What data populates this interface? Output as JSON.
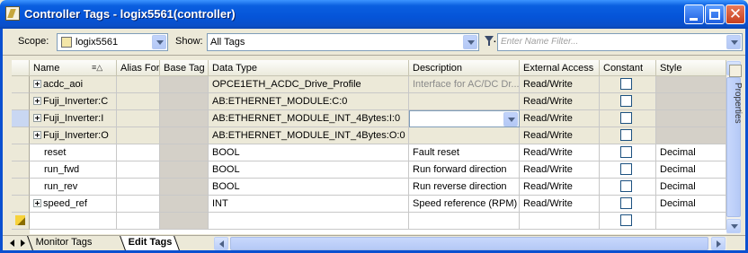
{
  "window": {
    "title": "Controller Tags - logix5561(controller)",
    "controls": [
      "minimize",
      "maximize",
      "close"
    ]
  },
  "toolbar": {
    "scope_label": "Scope:",
    "scope_value": "logix5561",
    "show_label": "Show:",
    "show_value": "All Tags",
    "filter_placeholder": "Enter Name Filter..."
  },
  "columns": [
    "Name",
    "Alias For",
    "Base Tag",
    "Data Type",
    "Description",
    "External Access",
    "Constant",
    "Style"
  ],
  "rows": [
    {
      "name": "acdc_aoi",
      "expandable": true,
      "alias": "",
      "base": "",
      "type": "OPCE1ETH_ACDC_Drive_Profile",
      "desc": "Interface for AC/DC Dr...",
      "access": "Read/Write",
      "constant": false,
      "style": ""
    },
    {
      "name": "Fuji_Inverter:C",
      "expandable": true,
      "alias": "",
      "base": "",
      "type": "AB:ETHERNET_MODULE:C:0",
      "desc": "",
      "access": "Read/Write",
      "constant": false,
      "style": ""
    },
    {
      "name": "Fuji_Inverter:I",
      "expandable": true,
      "alias": "",
      "base": "",
      "type": "AB:ETHERNET_MODULE_INT_4Bytes:I:0",
      "desc": "",
      "access": "Read/Write",
      "constant": false,
      "style": ""
    },
    {
      "name": "Fuji_Inverter:O",
      "expandable": true,
      "alias": "",
      "base": "",
      "type": "AB:ETHERNET_MODULE_INT_4Bytes:O:0",
      "desc": "",
      "access": "Read/Write",
      "constant": false,
      "style": ""
    },
    {
      "name": "reset",
      "expandable": false,
      "alias": "",
      "base": "",
      "type": "BOOL",
      "desc": "Fault reset",
      "access": "Read/Write",
      "constant": false,
      "style": "Decimal"
    },
    {
      "name": "run_fwd",
      "expandable": false,
      "alias": "",
      "base": "",
      "type": "BOOL",
      "desc": "Run forward direction",
      "access": "Read/Write",
      "constant": false,
      "style": "Decimal"
    },
    {
      "name": "run_rev",
      "expandable": false,
      "alias": "",
      "base": "",
      "type": "BOOL",
      "desc": "Run reverse direction",
      "access": "Read/Write",
      "constant": false,
      "style": "Decimal"
    },
    {
      "name": "speed_ref",
      "expandable": true,
      "alias": "",
      "base": "",
      "type": "INT",
      "desc": "Speed reference (RPM)",
      "access": "Read/Write",
      "constant": false,
      "style": "Decimal"
    },
    {
      "name": "",
      "expandable": false,
      "alias": "",
      "base": "",
      "type": "",
      "desc": "",
      "access": "",
      "constant": false,
      "style": ""
    }
  ],
  "tabs": [
    "Monitor Tags",
    "Edit Tags"
  ],
  "properties_tab": "Properties",
  "colors": {
    "title_bar": "#0554d8",
    "selected_row": "#ece9d8",
    "grey_column": "#d4d0c8"
  }
}
